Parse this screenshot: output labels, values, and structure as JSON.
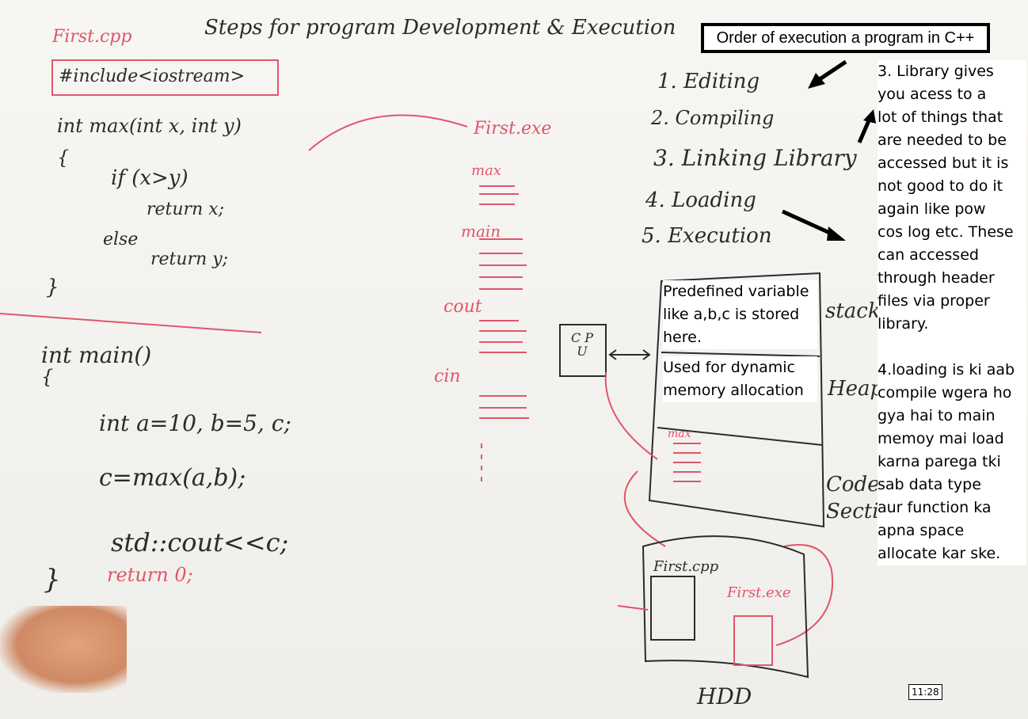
{
  "board": {
    "file_name": "First.cpp",
    "heading": "Steps for program Development & Execution",
    "include_line": "#include<iostream>",
    "code_max": [
      "int  max(int x, int y)",
      "{",
      "if (x>y)",
      "return x;",
      "else",
      "return y;",
      "}"
    ],
    "code_main": [
      "int  main()",
      "{",
      "int a=10, b=5, c;",
      "c=max(a,b);",
      "std::cout<<c;",
      "return 0;",
      "}"
    ],
    "exe_label": "First.exe",
    "sections": [
      "max",
      "main",
      "cout",
      "cin"
    ],
    "steps": [
      "1. Editing",
      "2. Compiling",
      "3. Linking Library",
      "4. Loading",
      "5. Execution"
    ],
    "cpu_label": "C P U",
    "memory_labels": [
      "stack",
      "Heap",
      "Code Section"
    ],
    "code_section_label": "max",
    "hdd_files": [
      "First.cpp",
      "First.exe"
    ],
    "hdd_label": "HDD"
  },
  "overlay": {
    "title": "Order of execution a program in C++",
    "note_lines": [
      "3. Library gives",
      "you acess to a",
      "lot of things that",
      "are needed to be",
      "accessed but it is",
      "not good to do it",
      "again like pow",
      "cos log etc. These",
      "can accessed",
      "through header",
      "files via proper",
      "library.",
      "",
      "4.loading is ki aab",
      "compile wgera ho",
      "gya hai to main",
      "memoy mai load",
      "karna parega tki",
      "sab data type",
      "aur function ka",
      "apna space",
      "allocate kar ske."
    ],
    "stack_note": [
      "Predefined variable",
      "like a,b,c is stored",
      "here."
    ],
    "heap_note": [
      "Used for dynamic",
      "memory allocation"
    ]
  },
  "player": {
    "timestamp": "11:28"
  },
  "colors": {
    "marker_red": "#e0566a",
    "marker_black": "#2b2b2b",
    "arrow": "#000000"
  }
}
